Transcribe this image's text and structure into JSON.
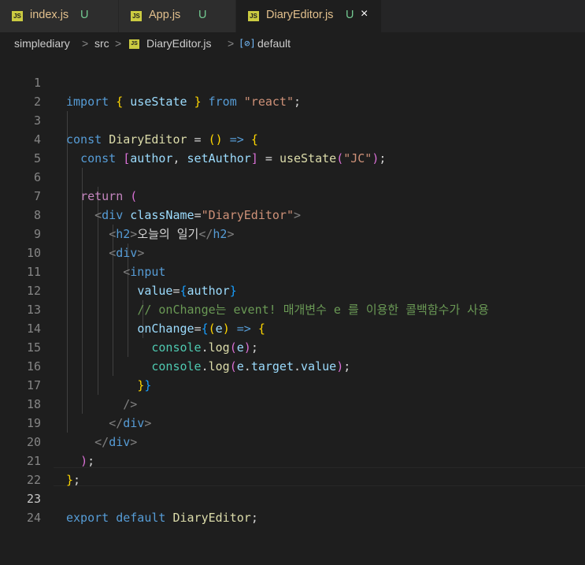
{
  "tabs": [
    {
      "name": "index.js",
      "status": "U",
      "icon": "js-file-icon",
      "active": false
    },
    {
      "name": "App.js",
      "status": "U",
      "icon": "js-file-icon",
      "active": false
    },
    {
      "name": "DiaryEditor.js",
      "status": "U",
      "icon": "js-file-icon",
      "active": true,
      "close": "×"
    }
  ],
  "breadcrumb": {
    "root": "simplediary",
    "folder": "src",
    "file": "DiaryEditor.js",
    "symbol": "default",
    "separator": ">",
    "file_icon": "JS",
    "symbol_icon": "[⊘]"
  },
  "editor": {
    "current_line": 23,
    "lines": [
      {
        "n": "1",
        "text": "import { useState } from \"react\";"
      },
      {
        "n": "2",
        "text": ""
      },
      {
        "n": "3",
        "text": "const DiaryEditor = () => {"
      },
      {
        "n": "4",
        "text": "  const [author, setAuthor] = useState(\"JC\");"
      },
      {
        "n": "5",
        "text": ""
      },
      {
        "n": "6",
        "text": "  return ("
      },
      {
        "n": "7",
        "text": "    <div className=\"DiaryEditor\">"
      },
      {
        "n": "8",
        "text": "      <h2>오늘의 일기</h2>"
      },
      {
        "n": "9",
        "text": "      <div>"
      },
      {
        "n": "10",
        "text": "        <input"
      },
      {
        "n": "11",
        "text": "          value={author}"
      },
      {
        "n": "12",
        "text": "          // onChange는 event! 매개변수 e 를 이용한 콜백함수가 사용"
      },
      {
        "n": "13",
        "text": "          onChange={(e) => {"
      },
      {
        "n": "14",
        "text": "            console.log(e);"
      },
      {
        "n": "15",
        "text": "            console.log(e.target.value);"
      },
      {
        "n": "16",
        "text": "          }}"
      },
      {
        "n": "17",
        "text": "        />"
      },
      {
        "n": "18",
        "text": "      </div>"
      },
      {
        "n": "19",
        "text": "    </div>"
      },
      {
        "n": "20",
        "text": "  );"
      },
      {
        "n": "21",
        "text": "};"
      },
      {
        "n": "22",
        "text": ""
      },
      {
        "n": "23",
        "text": "export default DiaryEditor;"
      },
      {
        "n": "24",
        "text": ""
      }
    ]
  },
  "colors": {
    "background": "#1e1e1e",
    "tab_inactive": "#2d2d2d",
    "untracked": "#73c991",
    "keyword": "#569cd6",
    "control": "#c586c0",
    "string": "#ce9178",
    "variable": "#9cdcfe",
    "function": "#dcdcaa",
    "comment": "#6a9955"
  }
}
